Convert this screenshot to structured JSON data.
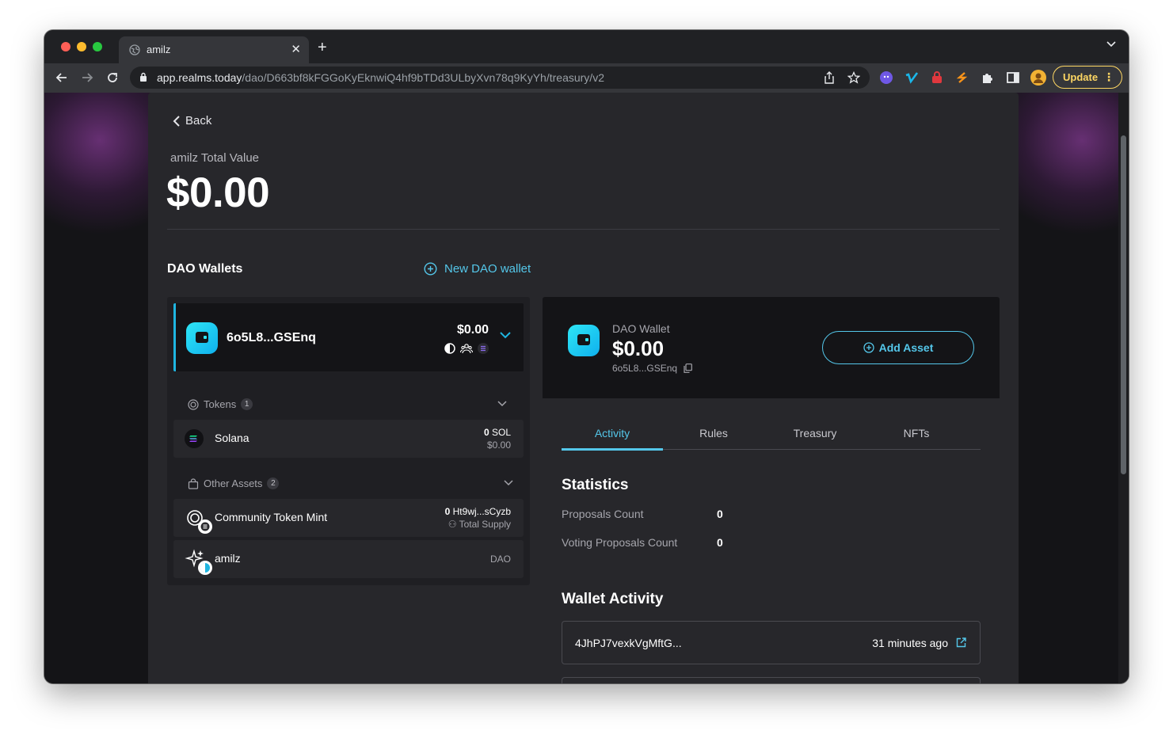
{
  "browser": {
    "tab_title": "amilz",
    "url_host": "app.realms.today",
    "url_path": "/dao/D663bf8kFGGoKyEknwiQ4hf9bTDd3ULbyXvn78q9KyYh/treasury/v2",
    "update_label": "Update"
  },
  "page": {
    "back_label": "Back",
    "total_value_label": "amilz Total Value",
    "total_value": "$0.00",
    "wallets_heading": "DAO Wallets",
    "new_wallet_label": "New DAO wallet"
  },
  "wallet_card": {
    "name": "6o5L8...GSEnq",
    "value": "$0.00"
  },
  "tokens_section": {
    "label": "Tokens",
    "count": "1",
    "items": [
      {
        "name": "Solana",
        "amount": "0",
        "unit": "SOL",
        "usd": "$0.00"
      }
    ]
  },
  "other_assets_section": {
    "label": "Other Assets",
    "count": "2",
    "items": [
      {
        "name": "Community Token Mint",
        "amount": "0",
        "unit": "Ht9wj...sCyzb",
        "sub": "Total Supply"
      },
      {
        "name": "amilz",
        "tag": "DAO"
      }
    ]
  },
  "detail": {
    "label": "DAO Wallet",
    "value": "$0.00",
    "address": "6o5L8...GSEnq",
    "add_asset_label": "Add Asset",
    "tabs": [
      "Activity",
      "Rules",
      "Treasury",
      "NFTs"
    ],
    "active_tab": "Activity",
    "statistics_heading": "Statistics",
    "stats": [
      {
        "label": "Proposals Count",
        "value": "0"
      },
      {
        "label": "Voting Proposals Count",
        "value": "0"
      }
    ],
    "activity_heading": "Wallet Activity",
    "activity": [
      {
        "tx": "4JhPJ7vexkVgMftG...",
        "when": "31 minutes ago"
      }
    ]
  },
  "colors": {
    "accent": "#54c7ea",
    "page_bg": "#141417",
    "panel_bg": "#27272b",
    "update": "#fdd663"
  }
}
